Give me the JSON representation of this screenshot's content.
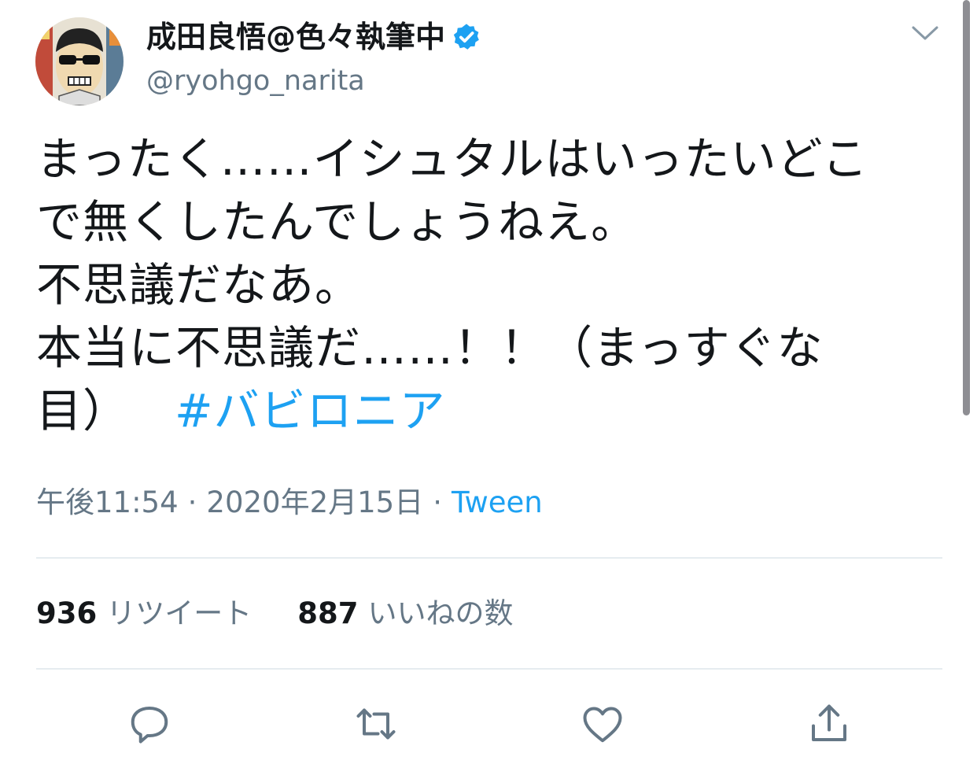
{
  "author": {
    "display_name": "成田良悟@色々執筆中",
    "handle": "@ryohgo_narita",
    "verified": true,
    "avatar_icon": "cartoon-avatar-icon"
  },
  "tweet": {
    "lines": [
      "まったく……イシュタルはいったいどこ",
      "で無くしたんでしょうねえ。",
      "不思議だなあ。",
      "本当に不思議だ……！！（まっすぐな"
    ],
    "last_line": "目）",
    "hashtag": "#バビロニア"
  },
  "meta": {
    "time": "午後11:54",
    "date": "2020年2月15日",
    "separator": "·",
    "source": "Tween"
  },
  "stats": {
    "retweet_count": "936",
    "retweet_label": "リツイート",
    "like_count": "887",
    "like_label": "いいねの数"
  },
  "actions": [
    "reply-icon",
    "retweet-icon",
    "like-icon",
    "share-icon"
  ],
  "colors": {
    "link": "#1da1f2",
    "secondary_text": "#657786",
    "primary_text": "#14171a",
    "divider": "#e6ecf0",
    "verified_badge": "#1da1f2"
  }
}
